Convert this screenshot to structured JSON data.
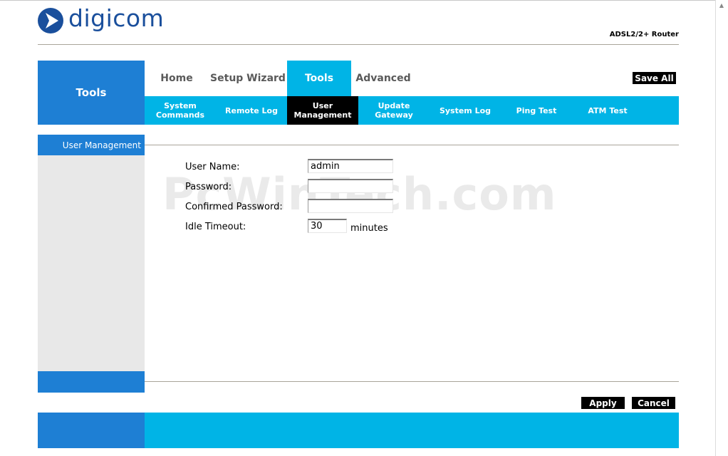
{
  "header": {
    "brand": "digicom",
    "product": "ADSL2/2+ Router"
  },
  "nav": {
    "section_title": "Tools",
    "tabs": [
      {
        "label": "Home",
        "active": false
      },
      {
        "label": "Setup Wizard",
        "active": false
      },
      {
        "label": "Tools",
        "active": true
      },
      {
        "label": "Advanced",
        "active": false
      }
    ],
    "save_all": "Save All",
    "subtabs": [
      {
        "label": "System\nCommands",
        "active": false
      },
      {
        "label": "Remote Log",
        "active": false
      },
      {
        "label": "User\nManagement",
        "active": true
      },
      {
        "label": "Update\nGateway",
        "active": false
      },
      {
        "label": "System Log",
        "active": false
      },
      {
        "label": "Ping Test",
        "active": false
      },
      {
        "label": "ATM Test",
        "active": false
      }
    ]
  },
  "side": {
    "title": "User Management"
  },
  "form": {
    "username_label": "User Name:",
    "username_value": "admin",
    "password_label": "Password:",
    "password_value": "",
    "confirm_label": "Confirmed Password:",
    "confirm_value": "",
    "idle_label": "Idle Timeout:",
    "idle_value": "30",
    "idle_unit": "minutes"
  },
  "watermark": "PcWinTech.com",
  "buttons": {
    "apply": "Apply",
    "cancel": "Cancel"
  },
  "colors": {
    "blue_dark": "#1e7fd4",
    "blue_light": "#00b4e6",
    "black": "#000000"
  }
}
